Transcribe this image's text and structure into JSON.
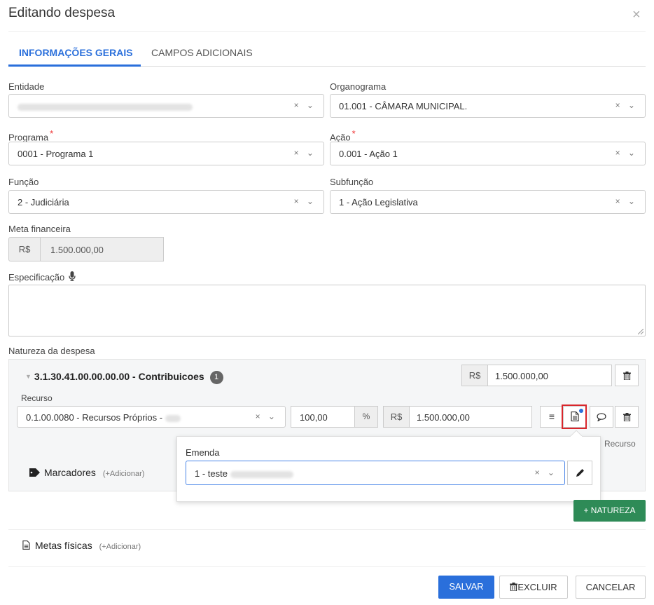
{
  "dialog": {
    "title": "Editando despesa",
    "close_icon": "×"
  },
  "tabs": [
    {
      "label": "INFORMAÇÕES GERAIS"
    },
    {
      "label": "CAMPOS ADICIONAIS"
    }
  ],
  "fields": {
    "entidade": {
      "label": "Entidade"
    },
    "organograma": {
      "label": "Organograma",
      "value": "01.001 - CÂMARA MUNICIPAL."
    },
    "programa": {
      "label": "Programa",
      "value": "0001 - Programa 1"
    },
    "acao": {
      "label": "Ação",
      "value": "0.001 - Ação 1"
    },
    "funcao": {
      "label": "Função",
      "value": "2 - Judiciária"
    },
    "subfuncao": {
      "label": "Subfunção",
      "value": "1 - Ação Legislativa"
    },
    "meta": {
      "label": "Meta financeira",
      "currency": "R$",
      "value": "1.500.000,00"
    },
    "especificacao": {
      "label": "Especificação"
    }
  },
  "required_mark": "*",
  "select_controls": "× ⌄",
  "natureza": {
    "label": "Natureza da despesa",
    "code": "3.1.30.41.00.00.00.00 - Contribuicoes",
    "count": "1",
    "currency": "R$",
    "value": "1.500.000,00",
    "recurso": {
      "label": "Recurso",
      "value": "0.1.00.0080 - Recursos Próprios -",
      "percent": "100,00",
      "percent_sign": "%",
      "currency": "R$",
      "amount": "1.500.000,00",
      "recurso_text": "Recurso"
    },
    "marcadores": {
      "label": "Marcadores",
      "add": "(+Adicionar)"
    }
  },
  "emenda": {
    "label": "Emenda",
    "value": "1 - teste"
  },
  "add_natureza": "+ NATUREZA",
  "metas": {
    "label": "Metas físicas",
    "add": "(+Adicionar)"
  },
  "footer": {
    "save": "SALVAR",
    "delete": "EXCLUIR",
    "cancel": "CANCELAR"
  },
  "colors": {
    "accent": "#2a6fdb",
    "success": "#2e8b57",
    "highlight": "#d9262c"
  }
}
